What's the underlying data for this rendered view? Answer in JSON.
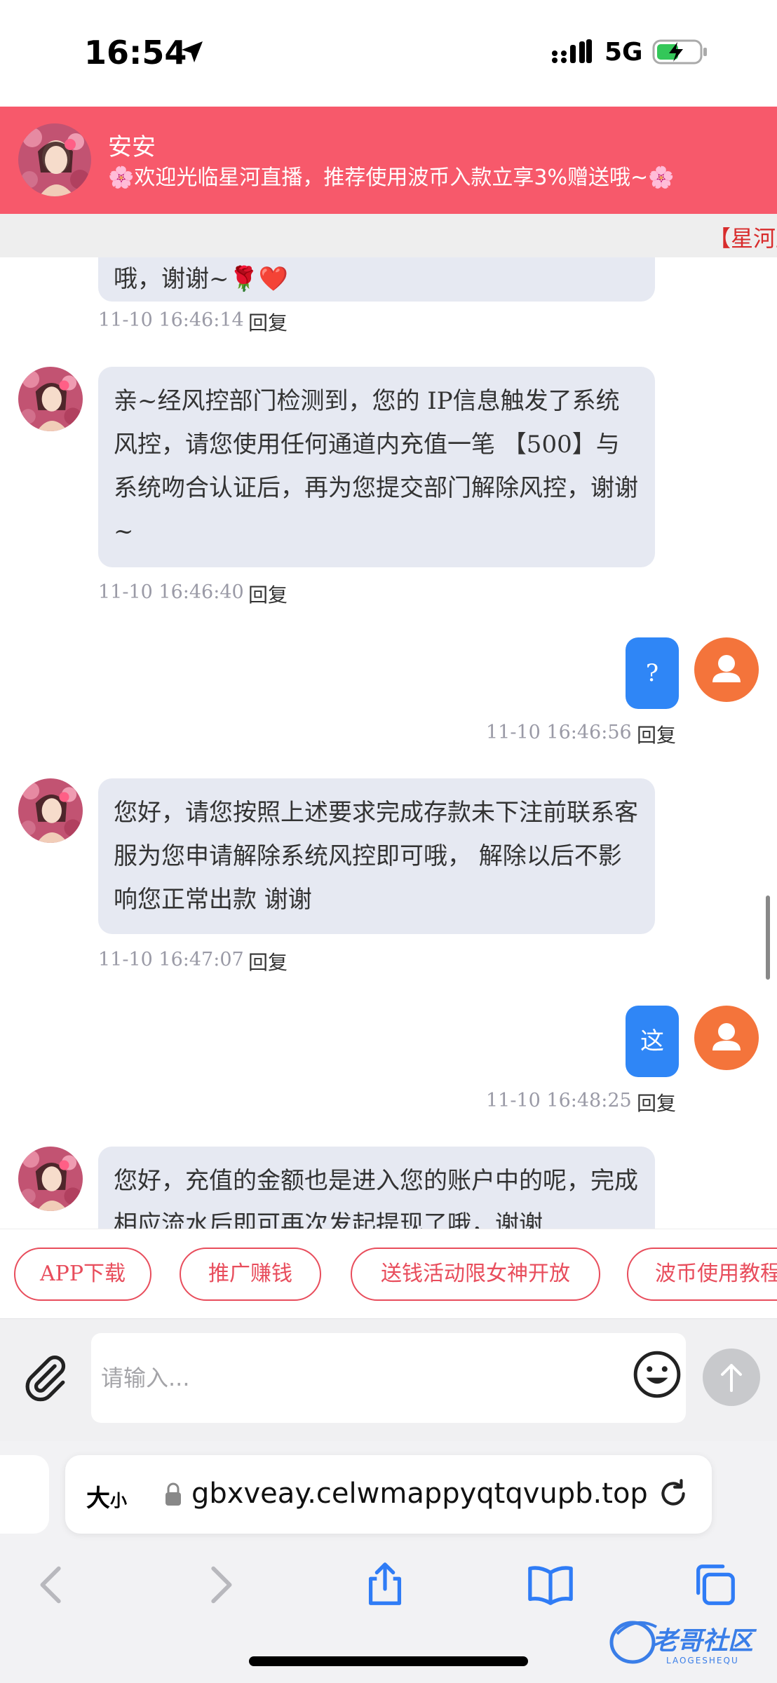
{
  "status_bar": {
    "time": "16:54",
    "network": "5G",
    "icons": [
      "location-arrow-icon",
      "cellular-signal-icon",
      "battery-charging-icon"
    ]
  },
  "header": {
    "name": "安安",
    "message": "🌸欢迎光临星河直播，推荐使用波币入款立享3%赠送哦~🌸",
    "marquee": "【星河直播"
  },
  "messages": {
    "m0": {
      "text_tail": "哦，谢谢~🌹❤️",
      "time": "11-10 16:46:14",
      "reply": "回复"
    },
    "m1": {
      "text": "亲~经风控部门检测到，您的 IP信息触发了系统风控，请您使用任何通道内充值一笔 【500】与系统吻合认证后，再为您提交部门解除风控，谢谢~",
      "time": "11-10 16:46:40",
      "reply": "回复"
    },
    "m2": {
      "text": "?",
      "time": "11-10 16:46:56",
      "reply": "回复"
    },
    "m3": {
      "text": "您好，请您按照上述要求完成存款未下注前联系客服为您申请解除系统风控即可哦， 解除以后不影响您正常出款 谢谢",
      "time": "11-10 16:47:07",
      "reply": "回复"
    },
    "m4": {
      "text": "这",
      "time": "11-10 16:48:25",
      "reply": "回复"
    },
    "m5": {
      "text": "您好，充值的金额也是进入您的账户中的呢，完成相应流水后即可再次发起提现了哦，谢谢"
    }
  },
  "tags": [
    "APP下载",
    "推广赚钱",
    "送钱活动限女神开放",
    "波币使用教程"
  ],
  "input": {
    "placeholder": "请输入..."
  },
  "browser": {
    "text_size_label": "大",
    "text_size_small": "小",
    "url": "gbxveay.celwmappyqtqvupb.top"
  },
  "watermark": {
    "text": "老哥社区",
    "sub": "LAOGESHEQU"
  },
  "colors": {
    "header_bg": "#f7596b",
    "bubble_in": "#e6e9f2",
    "bubble_out": "#2f86f6",
    "user_avatar": "#f4743b",
    "tag": "#e84d5c"
  }
}
